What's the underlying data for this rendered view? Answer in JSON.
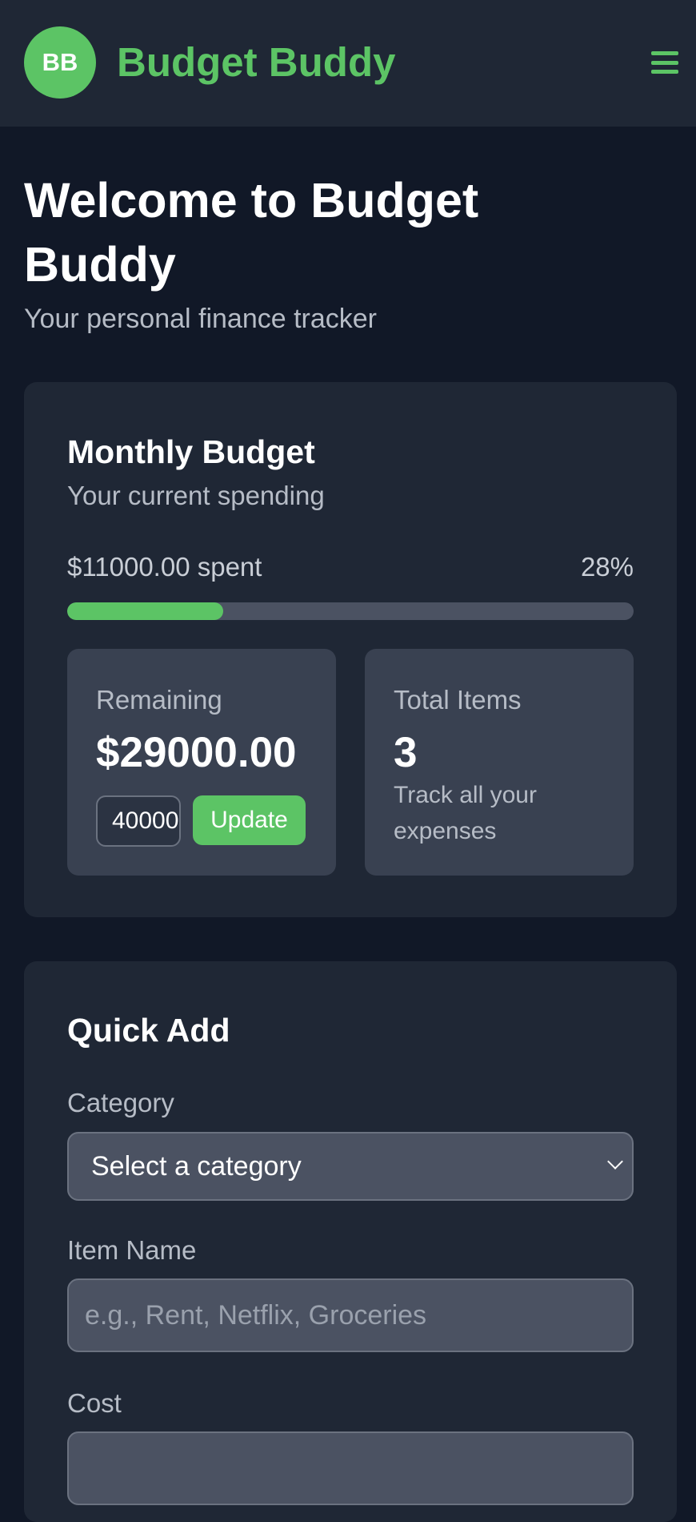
{
  "header": {
    "logo_initials": "BB",
    "app_name": "Budget Buddy",
    "menu_icon": "hamburger-menu-icon",
    "accent_color": "#5cc465"
  },
  "hero": {
    "title": "Welcome to Budget Buddy",
    "subtitle": "Your personal finance tracker"
  },
  "monthly_budget": {
    "title": "Monthly Budget",
    "subtitle": "Your current spending",
    "spent_text": "$11000.00 spent",
    "percent_text": "28%",
    "progress_fraction": 0.275,
    "remaining_label": "Remaining",
    "remaining_value": "$29000.00",
    "budget_input_value": "40000",
    "update_label": "Update",
    "total_items_label": "Total Items",
    "total_items_value": "3",
    "total_items_note": "Track all your expenses"
  },
  "quick_add": {
    "title": "Quick Add",
    "category_label": "Category",
    "category_selected": "Select a category",
    "item_name_label": "Item Name",
    "item_name_placeholder": "e.g., Rent, Netflix, Groceries",
    "cost_label": "Cost"
  }
}
